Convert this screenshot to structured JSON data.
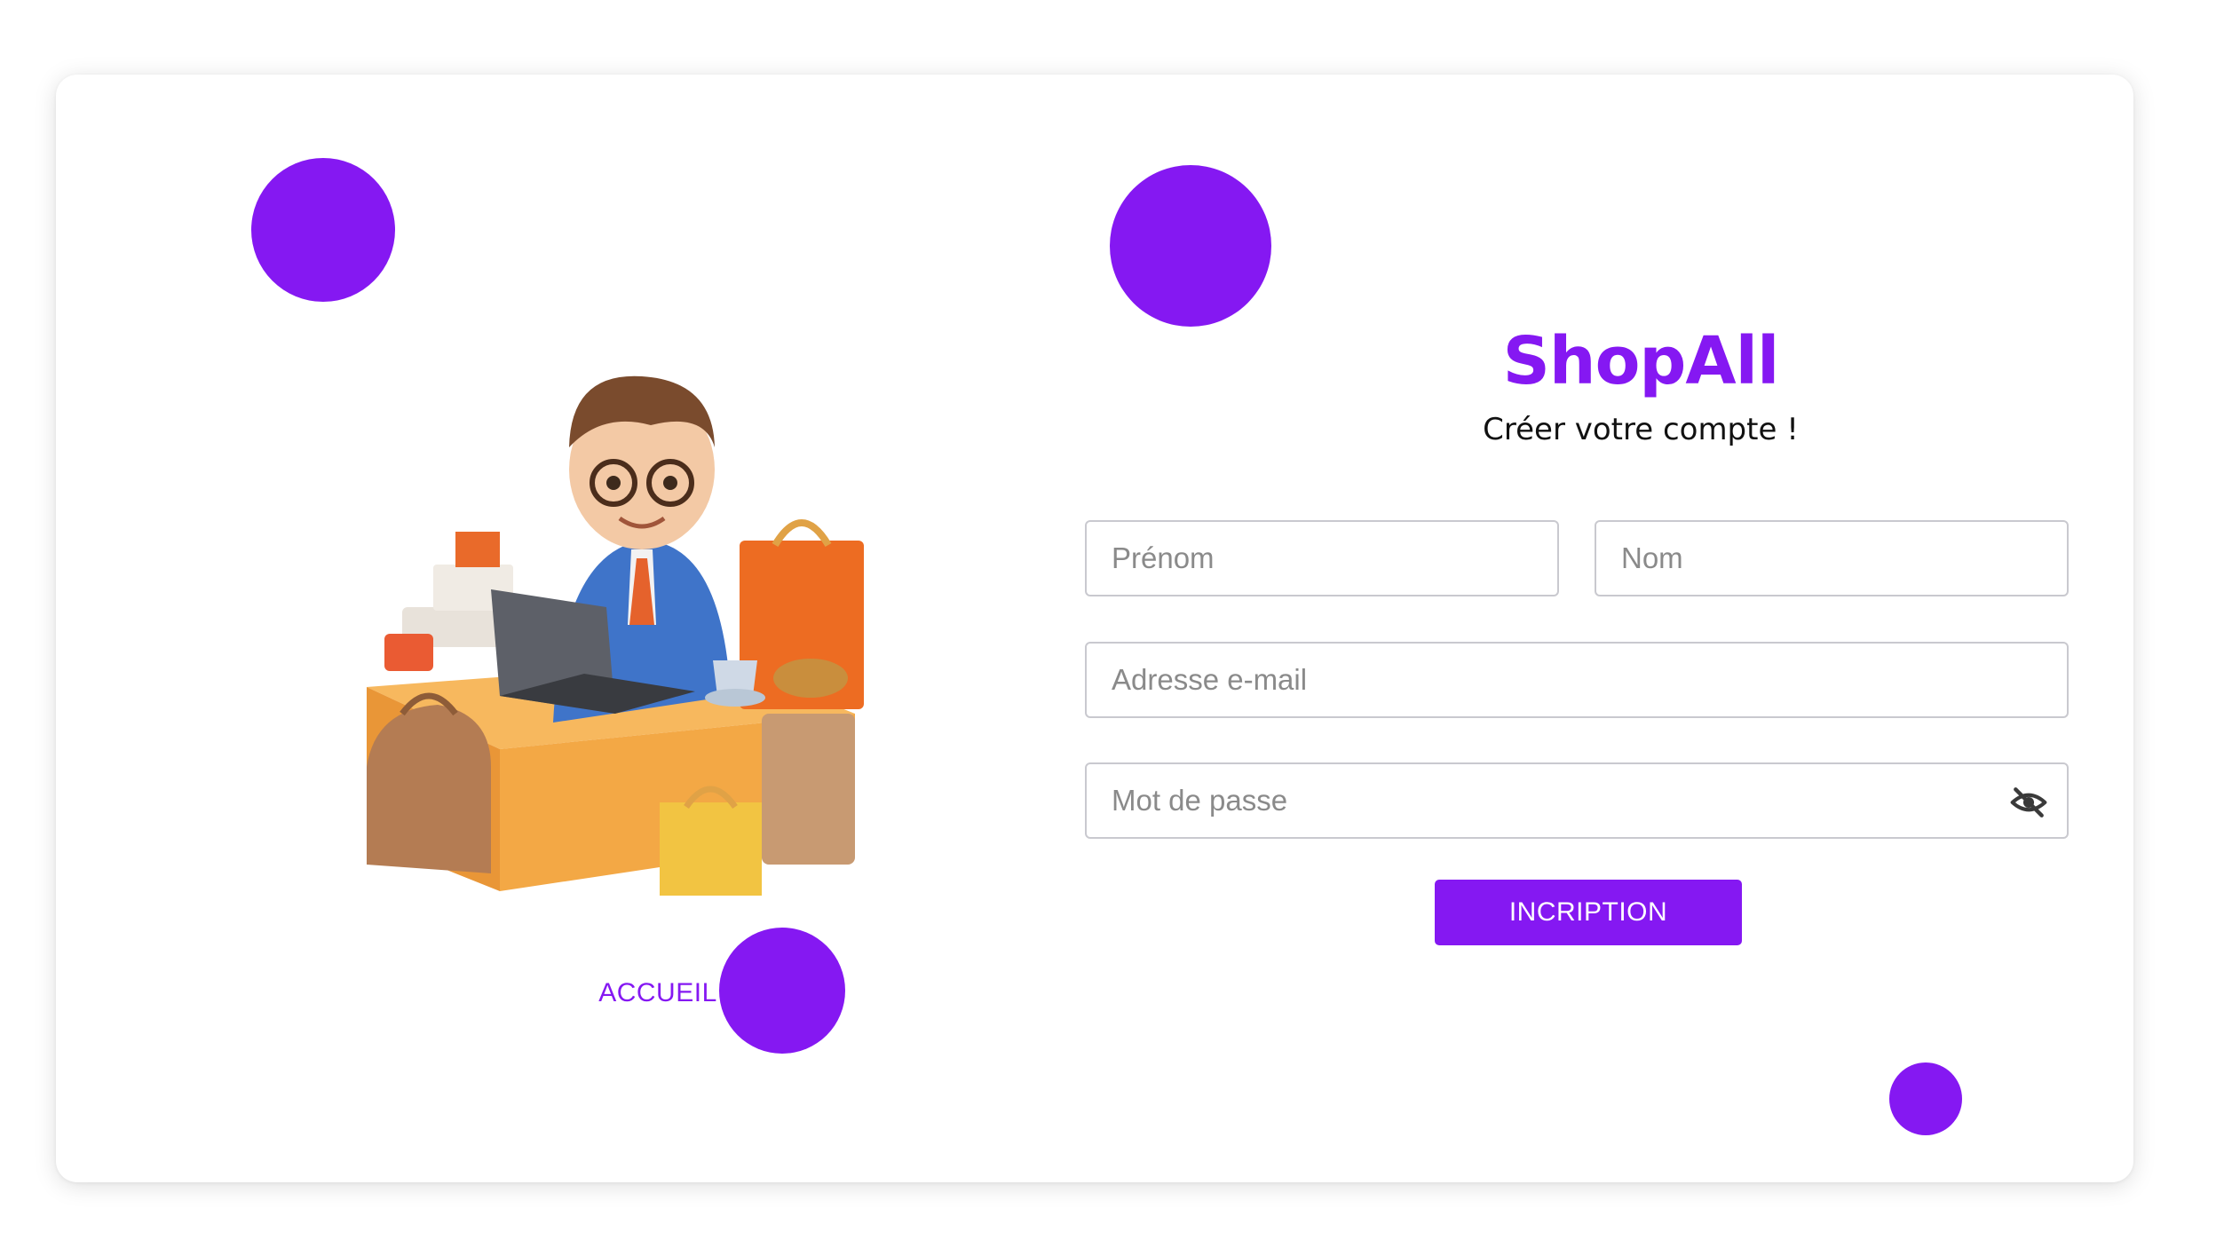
{
  "theme": {
    "accent": "#8518f2"
  },
  "hero": {
    "accueil_label": "ACCUEIL"
  },
  "form": {
    "brand": "ShopAll",
    "subtitle": "Créer votre compte !",
    "first_name_placeholder": "Prénom",
    "last_name_placeholder": "Nom",
    "email_placeholder": "Adresse e-mail",
    "password_placeholder": "Mot de passe",
    "submit_label": "INCRIPTION",
    "password_toggle_icon": "eye-slash-icon"
  }
}
